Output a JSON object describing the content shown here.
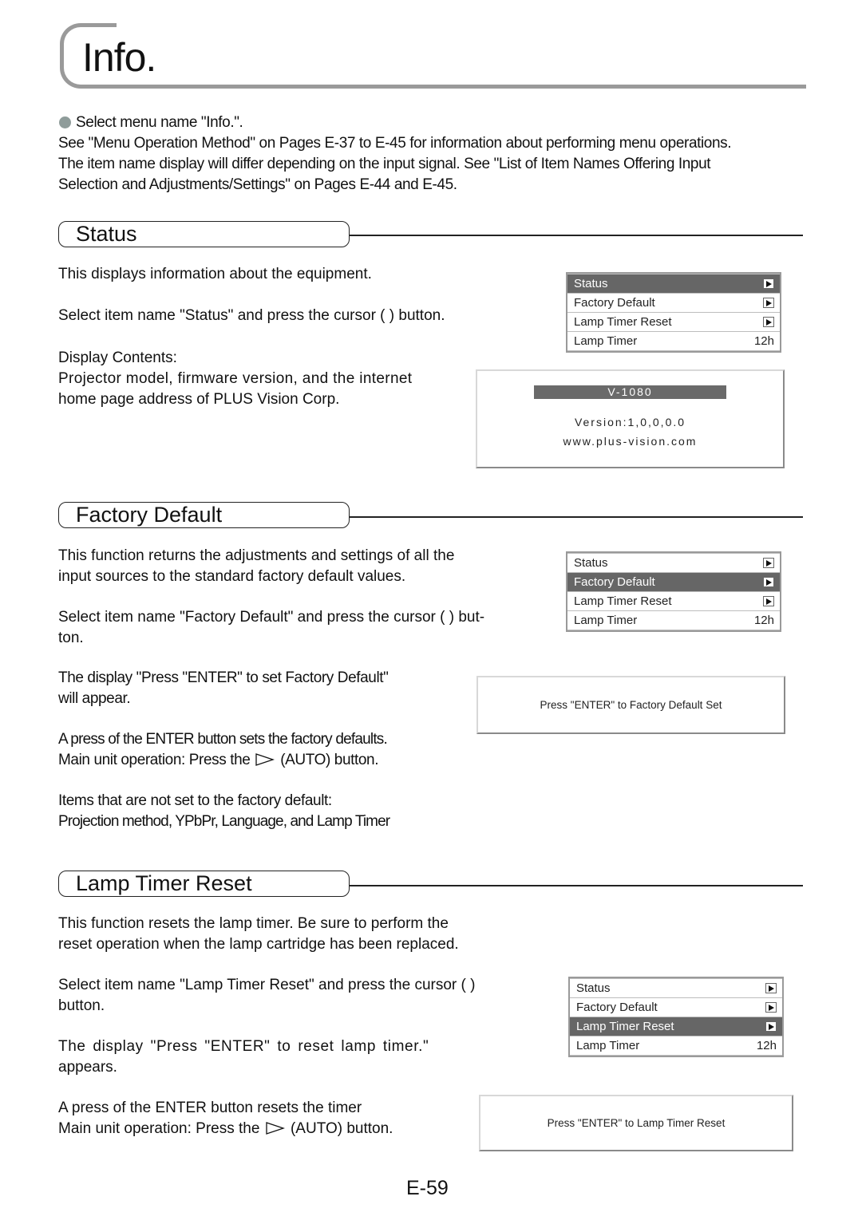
{
  "page": {
    "title": "Info.",
    "page_number": "E-59"
  },
  "intro": {
    "bullet_line": "Select menu name \"Info.\".",
    "lines": [
      "See \"Menu Operation Method\" on Pages E-37 to E-45 for information about performing menu operations.",
      "The item name display will differ depending on the input signal. See \"List of Item Names Offering Input",
      "Selection and Adjustments/Settings\" on Pages E-44 and E-45."
    ]
  },
  "menu_items": [
    {
      "label": "Status",
      "control": "arrow"
    },
    {
      "label": "Factory Default",
      "control": "arrow"
    },
    {
      "label": "Lamp Timer Reset",
      "control": "arrow"
    },
    {
      "label": "Lamp Timer",
      "value": "12h"
    }
  ],
  "sections": {
    "status": {
      "heading": "Status",
      "p1": "This displays information about the equipment.",
      "p2": "Select item name \"Status\" and press the cursor (   ) button.",
      "p3_lines": [
        "Display Contents:",
        "Projector model, firmware version, and the internet",
        "home page address of PLUS Vision Corp."
      ],
      "selected_item": "Status",
      "osd": {
        "model": "V-1080",
        "version": "Version:1,0,0,0.0",
        "url": "www.plus-vision.com"
      }
    },
    "factory_default": {
      "heading": "Factory Default",
      "p1_lines": [
        "This function returns the adjustments and settings of all the",
        "input sources to the standard factory default values."
      ],
      "p2_lines": [
        "Select item name \"Factory Default\" and press the cursor (   ) but-",
        "ton."
      ],
      "p3_lines": [
        "The display \"Press \"ENTER\" to set Factory Default\"",
        "will appear."
      ],
      "p4_line1": "A press of the ENTER button sets the factory defaults.",
      "p4_line2_pre": "Main unit operation: Press the",
      "p4_line2_post": "(AUTO) button.",
      "p5_lines": [
        "Items that are not set to the factory default:",
        "Projection method, YPbPr, Language, and Lamp Timer"
      ],
      "selected_item": "Factory Default",
      "osd_message": "Press \"ENTER\" to Factory Default Set"
    },
    "lamp_timer_reset": {
      "heading": "Lamp Timer Reset",
      "p1_lines": [
        "This function resets the lamp timer. Be sure to perform the",
        "reset operation when the lamp cartridge has been replaced."
      ],
      "p2_lines": [
        "Select item name \"Lamp Timer Reset\" and press the cursor (   )",
        "button."
      ],
      "p3_lines": [
        "The display \"Press \"ENTER\" to reset lamp timer.\"",
        "appears."
      ],
      "p4_line1": "A press of the ENTER button resets the timer",
      "p4_line2_pre": "Main unit operation: Press the",
      "p4_line2_post": "(AUTO) button.",
      "selected_item": "Lamp Timer Reset",
      "osd_message": "Press \"ENTER\" to Lamp Timer Reset"
    }
  },
  "colors": {
    "bracket_gray": "#9a9a9a",
    "bullet": "#8f9c9a",
    "menu_selected_bg": "#666666",
    "model_bar_bg": "#6a6a6a"
  }
}
